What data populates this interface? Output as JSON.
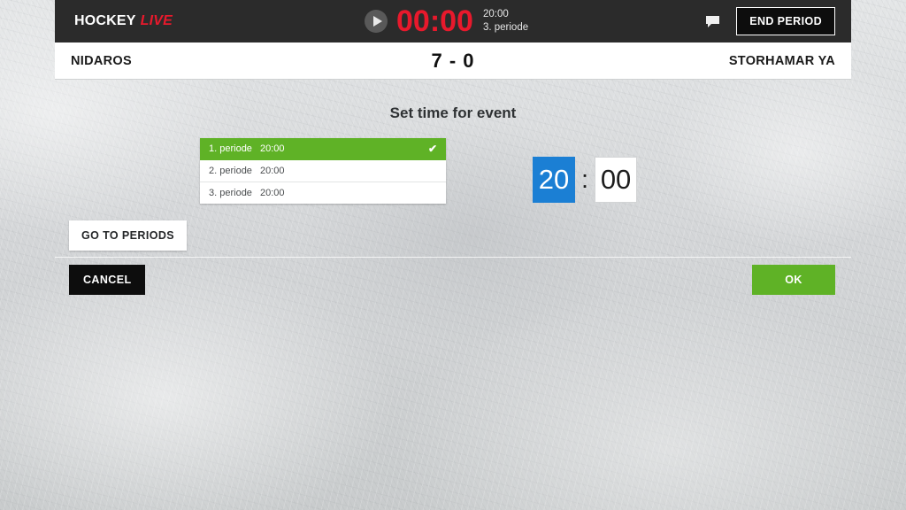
{
  "header": {
    "brand_primary": "HOCKEY",
    "brand_accent": "LIVE",
    "play_icon": "play-icon",
    "main_clock": "00:00",
    "period_length": "20:00",
    "period_label": "3. periode",
    "chat_icon": "chat-bubble-icon",
    "end_period_label": "END PERIOD"
  },
  "scoreboard": {
    "home_team": "NIDAROS",
    "away_team": "STORHAMAR YA",
    "score": "7 - 0"
  },
  "dialog": {
    "title": "Set time for event",
    "periods": [
      {
        "name": "1. periode",
        "time": "20:00",
        "selected": true,
        "check": "✔"
      },
      {
        "name": "2. periode",
        "time": "20:00",
        "selected": false,
        "check": ""
      },
      {
        "name": "3. periode",
        "time": "20:00",
        "selected": false,
        "check": ""
      }
    ],
    "time_minutes": "20",
    "time_separator": ":",
    "time_seconds": "00",
    "go_to_periods_label": "GO TO PERIODS",
    "cancel_label": "CANCEL",
    "ok_label": "OK"
  },
  "colors": {
    "accent_red": "#e8192c",
    "accent_green": "#5fb226",
    "accent_blue": "#1b7fd4",
    "header_dark": "#2b2b2b"
  }
}
